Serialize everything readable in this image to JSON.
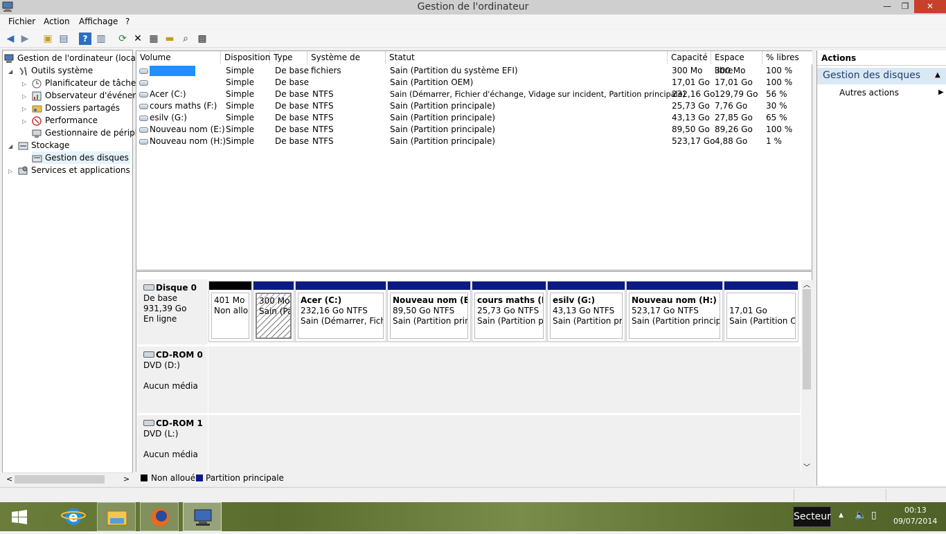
{
  "window": {
    "title": "Gestion de l'ordinateur",
    "minimize": "—",
    "maximize": "❐",
    "close": "✕"
  },
  "menu": [
    "Fichier",
    "Action",
    "Affichage",
    "?"
  ],
  "tree": {
    "root": "Gestion de l'ordinateur (local)",
    "outils": "Outils système",
    "planificateur": "Planificateur de tâches",
    "observateur": "Observateur d'événeme",
    "dossiers": "Dossiers partagés",
    "performance": "Performance",
    "gestionnaire": "Gestionnaire de périphé",
    "stockage": "Stockage",
    "gestion_disques": "Gestion des disques",
    "services": "Services et applications"
  },
  "columns": [
    "Volume",
    "Disposition",
    "Type",
    "Système de fichiers",
    "Statut",
    "Capacité",
    "Espace libre",
    "% libres"
  ],
  "volumes": [
    {
      "name": "",
      "layout": "Simple",
      "type": "De base",
      "fs": "",
      "status": "Sain (Partition du système EFI)",
      "capacity": "300 Mo",
      "free": "300 Mo",
      "pct": "100 %"
    },
    {
      "name": "",
      "layout": "Simple",
      "type": "De base",
      "fs": "",
      "status": "Sain (Partition OEM)",
      "capacity": "17,01 Go",
      "free": "17,01 Go",
      "pct": "100 %"
    },
    {
      "name": "Acer (C:)",
      "layout": "Simple",
      "type": "De base",
      "fs": "NTFS",
      "status": "Sain (Démarrer, Fichier d'échange, Vidage sur incident, Partition principale)",
      "capacity": "232,16 Go",
      "free": "129,79 Go",
      "pct": "56 %"
    },
    {
      "name": "cours maths (F:)",
      "layout": "Simple",
      "type": "De base",
      "fs": "NTFS",
      "status": "Sain (Partition principale)",
      "capacity": "25,73 Go",
      "free": "7,76 Go",
      "pct": "30 %"
    },
    {
      "name": "esilv (G:)",
      "layout": "Simple",
      "type": "De base",
      "fs": "NTFS",
      "status": "Sain (Partition principale)",
      "capacity": "43,13 Go",
      "free": "27,85 Go",
      "pct": "65 %"
    },
    {
      "name": "Nouveau nom (E:)",
      "layout": "Simple",
      "type": "De base",
      "fs": "NTFS",
      "status": "Sain (Partition principale)",
      "capacity": "89,50 Go",
      "free": "89,26 Go",
      "pct": "100 %"
    },
    {
      "name": "Nouveau nom (H:)",
      "layout": "Simple",
      "type": "De base",
      "fs": "NTFS",
      "status": "Sain (Partition principale)",
      "capacity": "523,17 Go",
      "free": "4,88 Go",
      "pct": "1 %"
    }
  ],
  "disk0": {
    "name": "Disque 0",
    "type": "De base",
    "size": "931,39 Go",
    "state": "En ligne",
    "partitions": [
      {
        "title": "",
        "l1": "401 Mo",
        "l2": "Non allou"
      },
      {
        "title": "",
        "l1": "300 Mo",
        "l2": "Sain (Par"
      },
      {
        "title": "Acer  (C:)",
        "l1": "232,16 Go NTFS",
        "l2": "Sain (Démarrer, Fichier"
      },
      {
        "title": "Nouveau nom  (E:)",
        "l1": "89,50 Go NTFS",
        "l2": "Sain (Partition princi"
      },
      {
        "title": "cours maths  (F:)",
        "l1": "25,73 Go NTFS",
        "l2": "Sain (Partition prin"
      },
      {
        "title": "esilv  (G:)",
        "l1": "43,13 Go NTFS",
        "l2": "Sain (Partition prin"
      },
      {
        "title": "Nouveau nom  (H:)",
        "l1": "523,17 Go NTFS",
        "l2": "Sain (Partition principal"
      },
      {
        "title": "",
        "l1": "17,01 Go",
        "l2": "Sain (Partition OE"
      }
    ]
  },
  "cdrom0": {
    "name": "CD-ROM 0",
    "drive": "DVD (D:)",
    "media": "Aucun média"
  },
  "cdrom1": {
    "name": "CD-ROM 1",
    "drive": "DVD (L:)",
    "media": "Aucun média"
  },
  "legend": {
    "unallocated": "Non alloué",
    "primary": "Partition principale"
  },
  "actions": {
    "header": "Actions",
    "section": "Gestion des disques",
    "more": "Autres actions"
  },
  "taskbar": {
    "language": "Secteur",
    "time": "00:13",
    "date": "09/07/2014"
  },
  "colors": {
    "primary_partition": "#0b1a84",
    "unallocated": "#000000",
    "close_button": "#c7402c"
  }
}
